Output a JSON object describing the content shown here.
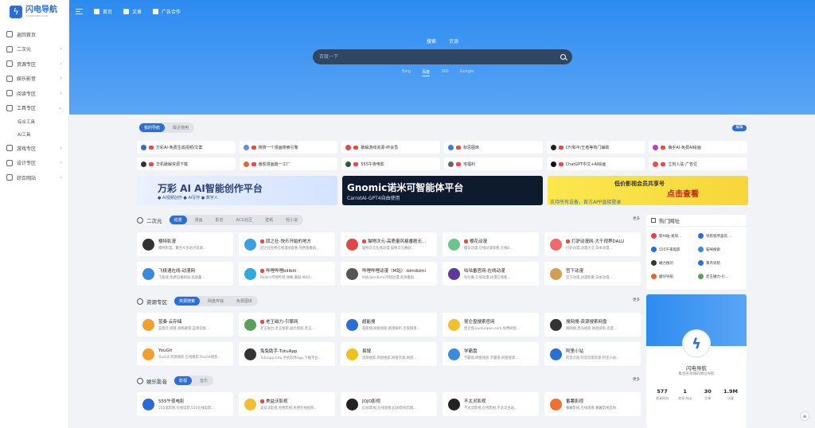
{
  "logo": {
    "title": "闪电导航",
    "sub": "SHANDIANDH.COM"
  },
  "sidebar": {
    "items": [
      {
        "label": "返回首页",
        "chev": ""
      },
      {
        "label": "二次元",
        "chev": "›"
      },
      {
        "label": "资源专区",
        "chev": "›"
      },
      {
        "label": "娱乐影音",
        "chev": "›"
      },
      {
        "label": "阅读专区",
        "chev": "›"
      },
      {
        "label": "工具专区",
        "chev": "⌄"
      }
    ],
    "sub": [
      "综合工具",
      "AI工具"
    ],
    "items2": [
      {
        "label": "游戏专区",
        "chev": "›"
      },
      {
        "label": "设计专区",
        "chev": "›"
      },
      {
        "label": "综合网站",
        "chev": "›"
      }
    ]
  },
  "topbar": {
    "home": "首页",
    "blog": "文章",
    "ads": "广告合作"
  },
  "search": {
    "tabs": [
      "搜索",
      "资源"
    ],
    "placeholder": "百度一下",
    "engines": [
      "Bing",
      "百度",
      "360",
      "Google"
    ]
  },
  "fav_tabs": [
    "我的导航",
    "最近使用"
  ],
  "edit_label": "编辑",
  "favs": [
    {
      "label": "万彩AI-免费生成视频/文案",
      "color": "#2b6fd6"
    },
    {
      "label": "搜搜一个漫画搜索引擎",
      "color": "#5b8df0"
    },
    {
      "label": "破解游戏资源-终会员",
      "color": "#e04848"
    },
    {
      "label": "秋思图床",
      "color": "#3a7ce0"
    },
    {
      "label": "CF/和平/王者等热门辅助",
      "color": "#222"
    },
    {
      "label": "萌手AI-免费AI绘画",
      "color": "#b040d0"
    },
    {
      "label": "华机破解资源下载",
      "color": "#333"
    },
    {
      "label": "番茄漫画篇一工厂",
      "color": "#e06a2a"
    },
    {
      "label": "555午夜电影",
      "color": "#2a5a3a"
    },
    {
      "label": "宅福利",
      "color": "#666"
    },
    {
      "label": "ChatGPT中文+AI绘画",
      "color": "#111"
    },
    {
      "label": "立刻入驻-广告位",
      "color": "#e05050"
    }
  ],
  "banners": {
    "b1": {
      "title": "万彩 AI AI智能创作平台",
      "sub": "● AI视频创作  ● AI写作  ● 数字人"
    },
    "b2": {
      "title": "Gnomic诺米可智能体平台",
      "sub": "CarrotAI-GPT4自由使用"
    },
    "b3": {
      "title": "低价影视会员共享号",
      "cta": "点击查看",
      "sub": "支持所有设备，首方APP直接登录"
    }
  },
  "acg": {
    "title": "二次元",
    "tabs": [
      "动漫",
      "漫画",
      "影音",
      "ACG社区",
      "壁纸",
      "轻小说"
    ],
    "more": "更多",
    "cards": [
      {
        "name": "樱特影漫",
        "desc": "樱特影漫，聚合众多站点资源...",
        "color": "#333",
        "hot": false
      },
      {
        "name": "囧之社-快乐开始的地方",
        "desc": "囧之社免费在线漫画观看,免费看番剧...",
        "color": "#3aa0e0",
        "hot": true
      },
      {
        "name": "猫物次元-高质量风格番剧无...",
        "desc": "猫物次元在线动漫,猫物次元番剧...",
        "color": "#e04848",
        "hot": true
      },
      {
        "name": "樱花动漫",
        "desc": "樱花动漫,在线动漫观看,在线B...",
        "color": "#6cc48c",
        "hot": true
      },
      {
        "name": "打驴动漫网-大千视界DALU",
        "desc": "打驴动漫,动漫大全,日本动漫...",
        "color": "#f06a6a",
        "hot": true
      },
      {
        "name": "飞极速在线-动漫网",
        "desc": "飞极速,免费追番网站,高质量...",
        "color": "#3a8ae0",
        "hot": false
      },
      {
        "name": "哔哩哔哩bilibili",
        "desc": "Bilibili,哔哩哔哩,弹幕,番剧,MAD...",
        "color": "#2eaadc",
        "hot": true
      },
      {
        "name": "哔哩哔哩动漫（M站）-bimibimi",
        "desc": "M站,bimibimi,哔哩动漫,高清番剧...",
        "color": "#555",
        "hot": false
      },
      {
        "name": "咕咕番官网-在线动漫",
        "desc": "咕咕番,在线动漫,动漫在线看...",
        "color": "#5a3aa0",
        "hot": false
      },
      {
        "name": "宫下动漫",
        "desc": "宫下动漫,动漫新番,日本动漫...",
        "color": "#d0a050",
        "hot": false
      }
    ]
  },
  "res": {
    "title": "资源专区",
    "tabs": [
      "资源搜索",
      "网盘传输",
      "免费图床"
    ],
    "more": "更多",
    "cards": [
      {
        "name": "蓝奏·云存储",
        "desc": "蓝奏云,网盘,网络硬盘,蓝奏云盘...",
        "color": "#f0a030",
        "hot": false
      },
      {
        "name": "老王磁力-引擎网",
        "desc": "老王磁力,老王搜索,磁力搜索,老王...",
        "color": "#5aa05a",
        "hot": true
      },
      {
        "name": "超能搜",
        "desc": "超能搜,网盘搜索,网盘解析,百度网盘...",
        "color": "#2b6fd6",
        "hot": false
      },
      {
        "name": "昆仑盘搜索官网",
        "desc": "昆仑盘,kunlunpan.com,免费网盘...",
        "color": "#f0c030",
        "hot": false
      },
      {
        "name": "搜网搜-资源搜索网盘",
        "desc": "搜网搜,星光搜索,网盘搜索,百度...",
        "color": "#333",
        "hot": false
      },
      {
        "name": "YouGit",
        "desc": "YouGit,资源搜索,在线搜索,YouGit搜索...",
        "color": "#f0a030",
        "hot": false
      },
      {
        "name": "兔兔助手-TutuApp",
        "desc": "Tutuapp,tutu,手机软件app,下载平台...",
        "color": "#333",
        "hot": false
      },
      {
        "name": "易搜",
        "desc": "资源搜索,网盘搜索,网盘资源,网盘...",
        "color": "#f0c020",
        "hot": false
      },
      {
        "name": "学霸盘",
        "desc": "学霸盘,网盘搜索,学霸盘,网盘搜索...",
        "color": "#3a8ae0",
        "hot": false
      },
      {
        "name": "阿里小站",
        "desc": "阿里云盘,阿里云盘资源,阿里小站...",
        "color": "#2b6fd6",
        "hot": false
      }
    ]
  },
  "ent": {
    "title": "娱乐影音",
    "tabs": [
      "影视",
      "音乐"
    ],
    "more": "更多",
    "cards": [
      {
        "name": "555午夜电影",
        "desc": "555电影网,在线电影,555在线电影...",
        "color": "#2a6ad6",
        "hot": false
      },
      {
        "name": "美益沃影视",
        "desc": "美益沃影视,免费影视,免费在线视频...",
        "color": "#f0c030",
        "hot": true
      },
      {
        "name": "JOJO影视",
        "desc": "JOJO影视,在线观看,JOJO影视官网...",
        "color": "#222",
        "hot": false
      },
      {
        "name": "不太灵影视",
        "desc": "不太灵影视,在线影视,不太灵主站...",
        "color": "#222",
        "hot": false
      },
      {
        "name": "番薯影视",
        "desc": "番薯影视,在线观看,番薯影视官网...",
        "color": "#f07030",
        "hot": false
      }
    ]
  },
  "hot": {
    "title": "热门网址",
    "items": [
      {
        "label": "新AI站-发现...",
        "color": "#e04848"
      },
      {
        "label": "导航程序盒欢...",
        "color": "#2b6fd6"
      },
      {
        "label": "555午夜电影",
        "color": "#2a6ad6"
      },
      {
        "label": "猫咪搜索",
        "color": "#3a8ae0"
      },
      {
        "label": "磁力搜尽",
        "color": "#333"
      },
      {
        "label": "黄鸟导航",
        "color": "#2b6fd6"
      },
      {
        "label": "磨仔导航",
        "color": "#e06a2a"
      },
      {
        "label": "老王磁力·引...",
        "color": "#5aa05a"
      }
    ]
  },
  "profile": {
    "name": "闪电导航",
    "desc": "集合各领域的网址导航",
    "stats": [
      {
        "v": "577",
        "l": "收录网站"
      },
      {
        "v": "1",
        "l": "收录 App"
      },
      {
        "v": "30",
        "l": "文章"
      },
      {
        "v": "1.9M",
        "l": "访客"
      }
    ]
  },
  "fab": "≡"
}
